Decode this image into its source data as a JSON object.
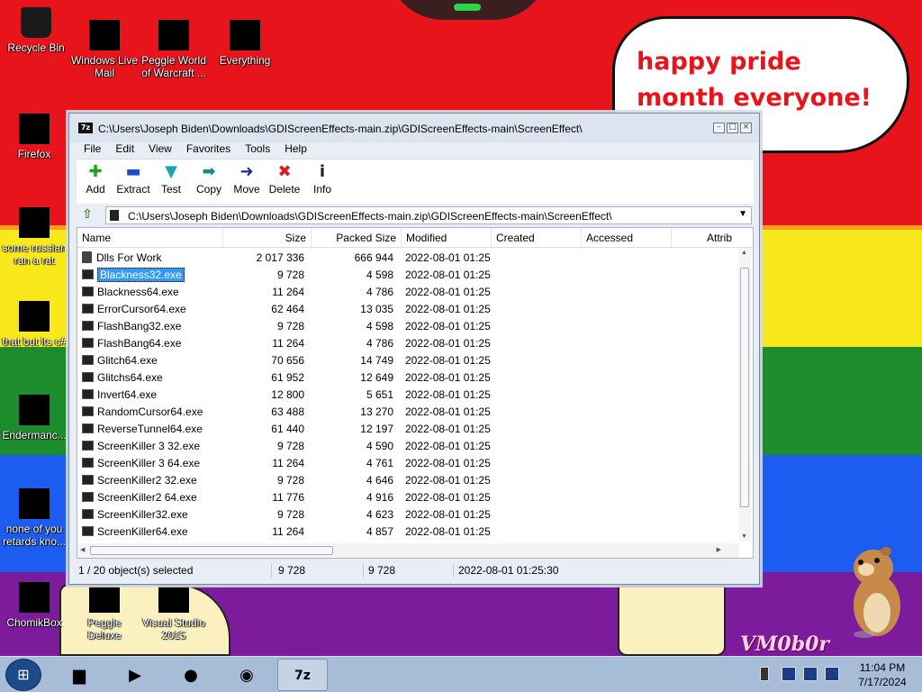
{
  "bubble_text": "happy pride month everyone!",
  "watermark": "VM0b0r",
  "desktop": {
    "icons": [
      {
        "label": "Recycle Bin"
      },
      {
        "label": "Windows Live Mail"
      },
      {
        "label": "Peggle World of Warcraft ..."
      },
      {
        "label": "Everything"
      },
      {
        "label": "Firefox"
      },
      {
        "label": "some russian ran a rat"
      },
      {
        "label": "that but its c#"
      },
      {
        "label": "Endermanc..."
      },
      {
        "label": "none of you retards kno..."
      },
      {
        "label": "ChomikBox"
      },
      {
        "label": "Peggle Deluxe"
      },
      {
        "label": "Visual Studio 2015"
      }
    ]
  },
  "window": {
    "app_icon": "7z",
    "title": "C:\\Users\\Joseph Biden\\Downloads\\GDIScreenEffects-main.zip\\GDIScreenEffects-main\\ScreenEffect\\",
    "menu": [
      "File",
      "Edit",
      "View",
      "Favorites",
      "Tools",
      "Help"
    ],
    "toolbar": [
      {
        "label": "Add",
        "icon": "plus-icon"
      },
      {
        "label": "Extract",
        "icon": "minus-icon"
      },
      {
        "label": "Test",
        "icon": "checkmark-icon"
      },
      {
        "label": "Copy",
        "icon": "arrow-right-double-icon"
      },
      {
        "label": "Move",
        "icon": "arrow-right-icon"
      },
      {
        "label": "Delete",
        "icon": "x-icon"
      },
      {
        "label": "Info",
        "icon": "info-icon"
      }
    ],
    "address": "C:\\Users\\Joseph Biden\\Downloads\\GDIScreenEffects-main.zip\\GDIScreenEffects-main\\ScreenEffect\\",
    "columns": [
      "Name",
      "Size",
      "Packed Size",
      "Modified",
      "Created",
      "Accessed",
      "Attrib"
    ],
    "rows": [
      {
        "name": "Dlls For Work",
        "size": "2 017 336",
        "packed": "666 944",
        "modified": "2022-08-01 01:25",
        "type": "folder"
      },
      {
        "name": "Blackness32.exe",
        "size": "9 728",
        "packed": "4 598",
        "modified": "2022-08-01 01:25",
        "type": "file",
        "selected": true
      },
      {
        "name": "Blackness64.exe",
        "size": "11 264",
        "packed": "4 786",
        "modified": "2022-08-01 01:25",
        "type": "file"
      },
      {
        "name": "ErrorCursor64.exe",
        "size": "62 464",
        "packed": "13 035",
        "modified": "2022-08-01 01:25",
        "type": "file"
      },
      {
        "name": "FlashBang32.exe",
        "size": "9 728",
        "packed": "4 598",
        "modified": "2022-08-01 01:25",
        "type": "file"
      },
      {
        "name": "FlashBang64.exe",
        "size": "11 264",
        "packed": "4 786",
        "modified": "2022-08-01 01:25",
        "type": "file"
      },
      {
        "name": "Glitch64.exe",
        "size": "70 656",
        "packed": "14 749",
        "modified": "2022-08-01 01:25",
        "type": "file"
      },
      {
        "name": "Glitchs64.exe",
        "size": "61 952",
        "packed": "12 649",
        "modified": "2022-08-01 01:25",
        "type": "file"
      },
      {
        "name": "Invert64.exe",
        "size": "12 800",
        "packed": "5 651",
        "modified": "2022-08-01 01:25",
        "type": "file"
      },
      {
        "name": "RandomCursor64.exe",
        "size": "63 488",
        "packed": "13 270",
        "modified": "2022-08-01 01:25",
        "type": "file"
      },
      {
        "name": "ReverseTunnel64.exe",
        "size": "61 440",
        "packed": "12 197",
        "modified": "2022-08-01 01:25",
        "type": "file"
      },
      {
        "name": "ScreenKiller 3 32.exe",
        "size": "9 728",
        "packed": "4 590",
        "modified": "2022-08-01 01:25",
        "type": "file"
      },
      {
        "name": "ScreenKiller 3 64.exe",
        "size": "11 264",
        "packed": "4 761",
        "modified": "2022-08-01 01:25",
        "type": "file"
      },
      {
        "name": "ScreenKiller2 32.exe",
        "size": "9 728",
        "packed": "4 646",
        "modified": "2022-08-01 01:25",
        "type": "file"
      },
      {
        "name": "ScreenKiller2 64.exe",
        "size": "11 776",
        "packed": "4 916",
        "modified": "2022-08-01 01:25",
        "type": "file"
      },
      {
        "name": "ScreenKiller32.exe",
        "size": "9 728",
        "packed": "4 623",
        "modified": "2022-08-01 01:25",
        "type": "file"
      },
      {
        "name": "ScreenKiller64.exe",
        "size": "11 264",
        "packed": "4 857",
        "modified": "2022-08-01 01:25",
        "type": "file"
      }
    ],
    "status": {
      "selection": "1 / 20 object(s) selected",
      "size": "9 728",
      "packed": "9 728",
      "modified": "2022-08-01 01:25:30"
    }
  },
  "taskbar": {
    "time": "11:04 PM",
    "date": "7/17/2024",
    "active_app": "7z"
  }
}
